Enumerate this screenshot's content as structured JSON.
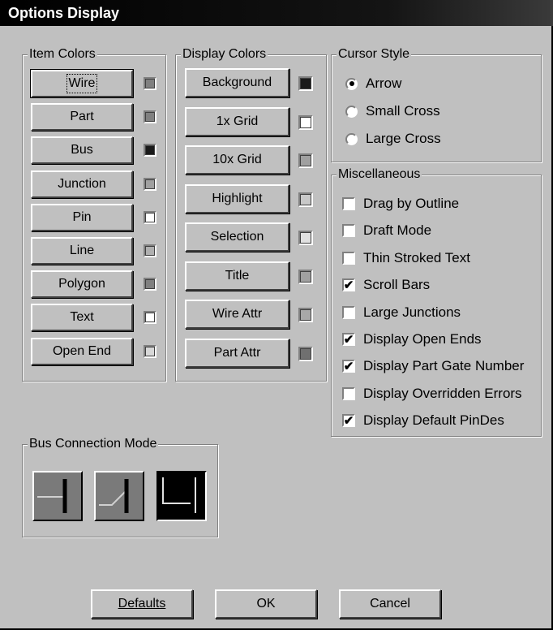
{
  "window": {
    "title": "Options Display"
  },
  "item_colors": {
    "legend": "Item Colors",
    "items": [
      {
        "label": "Wire",
        "color": "#808080"
      },
      {
        "label": "Part",
        "color": "#808080"
      },
      {
        "label": "Bus",
        "color": "#1a1a1a"
      },
      {
        "label": "Junction",
        "color": "#a0a0a0"
      },
      {
        "label": "Pin",
        "color": "#ffffff"
      },
      {
        "label": "Line",
        "color": "#b0b0b0"
      },
      {
        "label": "Polygon",
        "color": "#808080"
      },
      {
        "label": "Text",
        "color": "#ffffff"
      },
      {
        "label": "Open End",
        "color": "#d8d8d8"
      }
    ]
  },
  "display_colors": {
    "legend": "Display Colors",
    "items": [
      {
        "label": "Background",
        "color": "#1a1a1a"
      },
      {
        "label": "1x Grid",
        "color": "#ffffff"
      },
      {
        "label": "10x Grid",
        "color": "#a0a0a0"
      },
      {
        "label": "Highlight",
        "color": "#c8c8c8"
      },
      {
        "label": "Selection",
        "color": "#e0e0e0"
      },
      {
        "label": "Title",
        "color": "#a0a0a0"
      },
      {
        "label": "Wire Attr",
        "color": "#a8a8a8"
      },
      {
        "label": "Part Attr",
        "color": "#707070"
      }
    ]
  },
  "cursor_style": {
    "legend": "Cursor Style",
    "options": [
      {
        "label": "Arrow",
        "selected": true
      },
      {
        "label": "Small Cross",
        "selected": false
      },
      {
        "label": "Large Cross",
        "selected": false
      }
    ]
  },
  "miscellaneous": {
    "legend": "Miscellaneous",
    "options": [
      {
        "label": "Drag by Outline",
        "checked": false
      },
      {
        "label": "Draft Mode",
        "checked": false
      },
      {
        "label": "Thin Stroked Text",
        "checked": false
      },
      {
        "label": "Scroll Bars",
        "checked": true
      },
      {
        "label": "Large Junctions",
        "checked": false
      },
      {
        "label": "Display Open Ends",
        "checked": true
      },
      {
        "label": "Display Part Gate Number",
        "checked": true
      },
      {
        "label": "Display Overridden Errors",
        "checked": false
      },
      {
        "label": "Display Default PinDes",
        "checked": true
      }
    ],
    "check_glyph": "✔"
  },
  "bus_connection": {
    "legend": "Bus Connection Mode",
    "modes": [
      "straight",
      "angled",
      "corner"
    ],
    "selected": "corner"
  },
  "buttons": {
    "defaults": "Defaults",
    "ok": "OK",
    "cancel": "Cancel"
  }
}
